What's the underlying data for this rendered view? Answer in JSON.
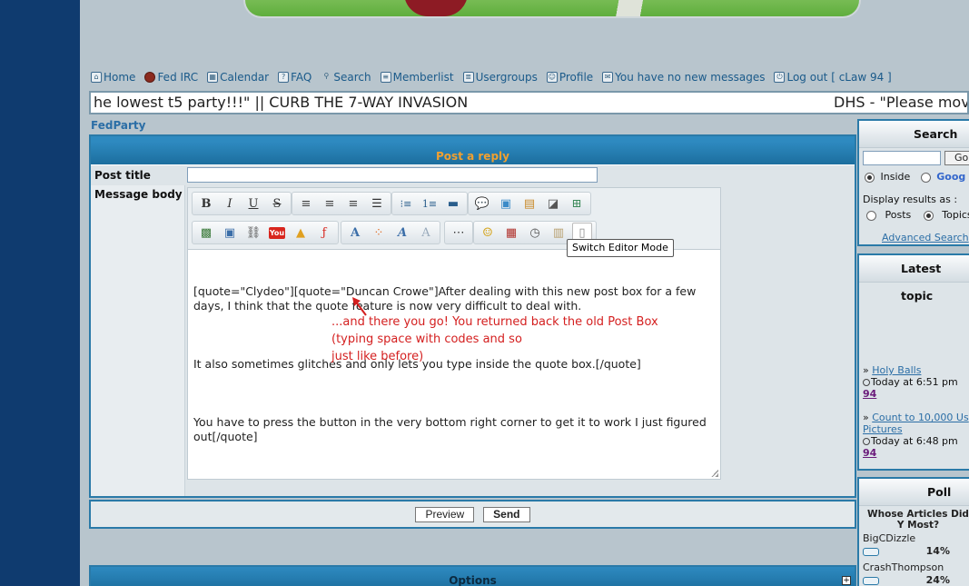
{
  "nav": [
    {
      "label": "Home",
      "icon": "home-icon"
    },
    {
      "label": "Fed IRC",
      "icon": "irc-icon"
    },
    {
      "label": "Calendar",
      "icon": "calendar-icon"
    },
    {
      "label": "FAQ",
      "icon": "faq-icon"
    },
    {
      "label": "Search",
      "icon": "search-icon"
    },
    {
      "label": "Memberlist",
      "icon": "memberlist-icon"
    },
    {
      "label": "Usergroups",
      "icon": "usergroups-icon"
    },
    {
      "label": "Profile",
      "icon": "profile-icon"
    },
    {
      "label": "You have no new messages",
      "icon": "messages-icon"
    },
    {
      "label": "Log out [ cLaw 94 ]",
      "icon": "logout-icon"
    }
  ],
  "marquee": {
    "left": "he lowest t5 party!!!\" || CURB THE 7-WAY INVASION",
    "right": "DHS - \"Please mov"
  },
  "breadcrumb": "FedParty",
  "post": {
    "header": "Post a reply",
    "title_label": "Post title",
    "body_label": "Message body",
    "tooltip": "Switch Editor Mode",
    "paragraphs": [
      "[quote=\"Clydeo\"][quote=\"Duncan Crowe\"]After dealing with this new post box for a few days, I think that the quote feature is now very difficult to deal with.",
      "It also sometimes glitches and only lets you type inside the quote box.[/quote]",
      "You have to press the button in the very bottom right corner to get it to work I just figured out[/quote]"
    ],
    "annotation": [
      "...and there you go! You returned back the old Post Box",
      "(typing space with codes and so",
      "just like before)"
    ],
    "preview_label": "Preview",
    "send_label": "Send"
  },
  "options_title": "Options",
  "sidebar": {
    "search": {
      "title": "Search",
      "go_label": "Go",
      "inside_label": "Inside",
      "google_label": "Goog",
      "display_label": "Display results as :",
      "posts_label": "Posts",
      "topics_label": "Topics",
      "advanced_label": "Advanced Search"
    },
    "latest": {
      "title": "Latest topic",
      "topics": [
        {
          "lines": [
            "Holy Balls"
          ],
          "time": "Today at 6:51 pm",
          "user": "94"
        },
        {
          "lines": [
            "Count to 10,000 Us",
            "Pictures"
          ],
          "time": "Today at 6:48 pm",
          "user": "94"
        }
      ]
    },
    "poll": {
      "title": "Poll",
      "question": "Whose Articles Did Y Most?",
      "options": [
        {
          "name": "BigCDizzle",
          "percent": "14%"
        },
        {
          "name": "CrashThompson",
          "percent": "24%"
        }
      ]
    }
  }
}
